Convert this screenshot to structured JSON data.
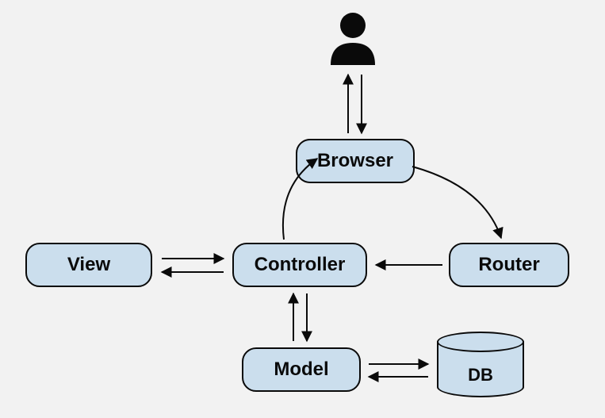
{
  "diagram": {
    "nodes": {
      "view": "View",
      "controller": "Controller",
      "router": "Router",
      "browser": "Browser",
      "model": "Model",
      "db": "DB"
    },
    "icons": {
      "user": "user-icon"
    },
    "connections": [
      {
        "from": "user",
        "to": "browser",
        "type": "bidirectional"
      },
      {
        "from": "browser",
        "to": "router",
        "type": "unidirectional"
      },
      {
        "from": "router",
        "to": "controller",
        "type": "unidirectional"
      },
      {
        "from": "controller",
        "to": "browser",
        "type": "unidirectional"
      },
      {
        "from": "controller",
        "to": "view",
        "type": "bidirectional"
      },
      {
        "from": "controller",
        "to": "model",
        "type": "bidirectional"
      },
      {
        "from": "model",
        "to": "db",
        "type": "bidirectional"
      }
    ],
    "colors": {
      "node_fill": "#cbdeed",
      "node_stroke": "#0a0a0a",
      "background": "#f2f2f2"
    }
  }
}
